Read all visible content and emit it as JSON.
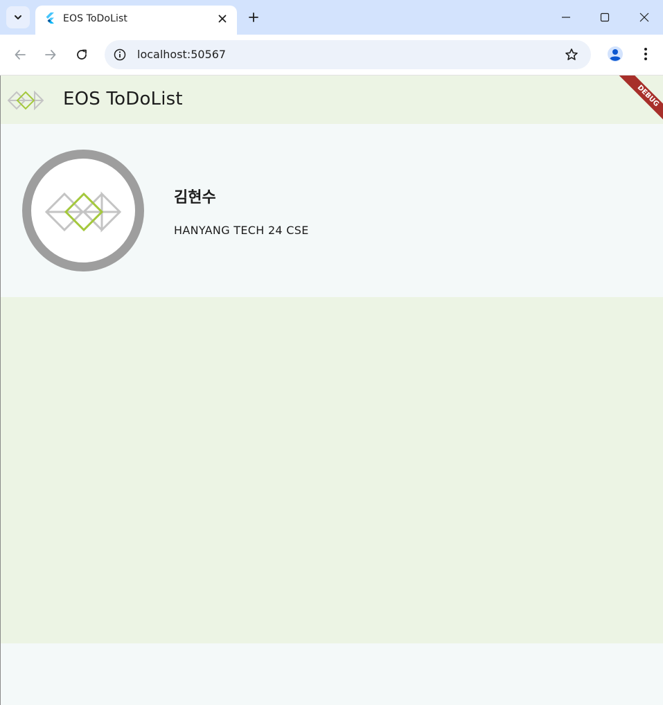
{
  "browser": {
    "tab_title": "EOS ToDoList",
    "url": "localhost:50567",
    "accent": "#d3e3fd"
  },
  "app": {
    "title": "EOS ToDoList",
    "debug_label": "DEBUG",
    "appbar_color": "#ecf4e4",
    "logo_colors": {
      "gray": "#c4c4c4",
      "green": "#a4c83c"
    }
  },
  "profile": {
    "name": "김현수",
    "affiliation": "HANYANG TECH 24 CSE"
  }
}
